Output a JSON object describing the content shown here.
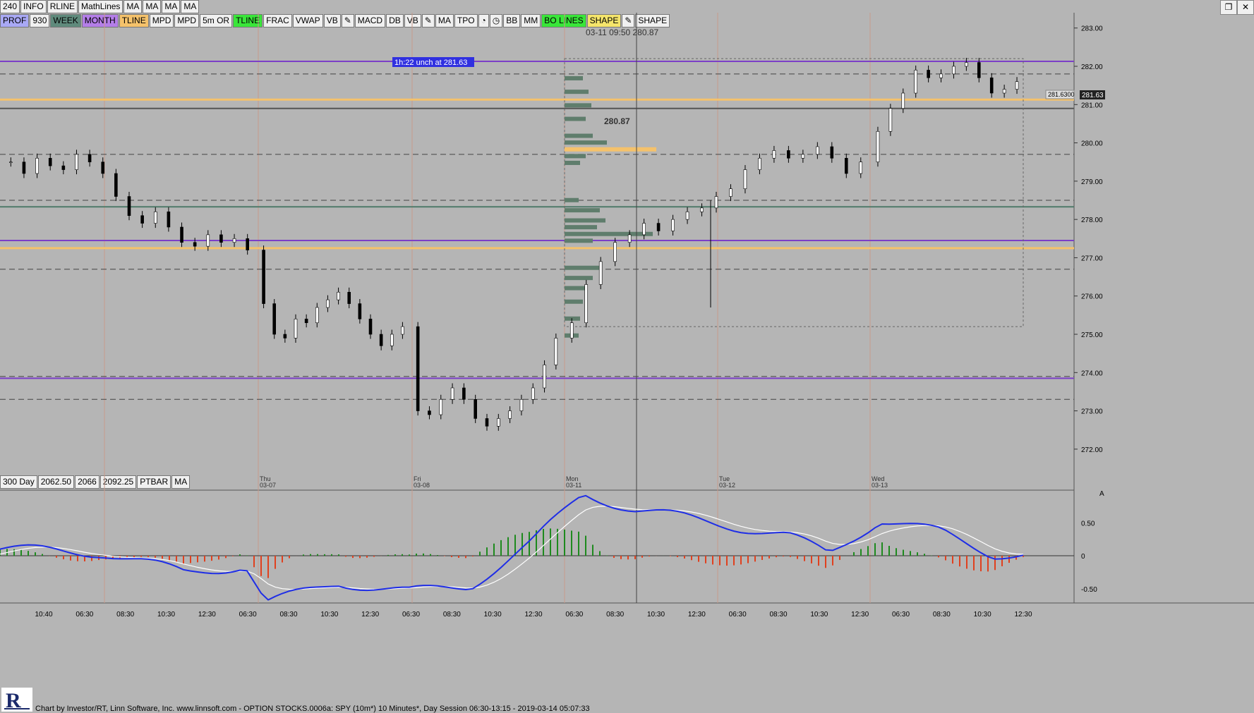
{
  "toolbar_top": [
    "240",
    "INFO",
    "RLINE",
    "MathLines",
    "MA",
    "MA",
    "MA",
    "MA"
  ],
  "toolbar_second": [
    {
      "label": "PROF",
      "bg": "#a9a9f5"
    },
    {
      "label": "930",
      "bg": "#f0f0f0"
    },
    {
      "label": "WEEK",
      "bg": "#5f8a7c"
    },
    {
      "label": "MONTH",
      "bg": "#b47ee8"
    },
    {
      "label": "TLINE",
      "bg": "#f5c26b"
    },
    {
      "label": "MPD",
      "bg": "#f0f0f0"
    },
    {
      "label": "MPD",
      "bg": "#f0f0f0"
    },
    {
      "label": "5m OR",
      "bg": "#f0f0f0"
    },
    {
      "label": "TLINE",
      "bg": "#39e639"
    },
    {
      "label": "FRAC",
      "bg": "#f0f0f0"
    },
    {
      "label": "VWAP",
      "bg": "#f0f0f0"
    },
    {
      "label": "VB",
      "bg": "#f0f0f0"
    },
    {
      "label": "✎",
      "bg": "#f0f0f0"
    },
    {
      "label": "MACD",
      "bg": "#f0f0f0"
    },
    {
      "label": "DB",
      "bg": "#f0f0f0"
    },
    {
      "label": "VB",
      "bg": "#f0f0f0"
    },
    {
      "label": "✎",
      "bg": "#f0f0f0"
    },
    {
      "label": "MA",
      "bg": "#f0f0f0"
    },
    {
      "label": "TPO",
      "bg": "#f0f0f0"
    },
    {
      "label": "◔",
      "bg": "#f0f0f0"
    },
    {
      "label": "◷",
      "bg": "#f0f0f0"
    },
    {
      "label": "BB",
      "bg": "#f0f0f0"
    },
    {
      "label": "MM",
      "bg": "#f0f0f0"
    },
    {
      "label": "BO LINES",
      "bg": "#39e639"
    },
    {
      "label": "SHAPE",
      "bg": "#f5e56b"
    },
    {
      "label": "✎",
      "bg": "#f0f0f0"
    },
    {
      "label": "SHAPE",
      "bg": "#f0f0f0"
    }
  ],
  "toolbar_bottom": [
    "300 Day",
    "2062.50",
    "2066",
    "2092.25",
    "PTBAR",
    "MA"
  ],
  "window_controls": [
    "❐",
    "✕"
  ],
  "footer_text": "Chart by Investor/RT, Linn Software, Inc. www.linnsoft.com - OPTION STOCKS.0006a: SPY (10m*) 10 Minutes*, Day Session 06:30-13:15 - 2019-03-14 05:07:33",
  "colors": {
    "up": "#ffffff",
    "down": "#000000",
    "purple": "#7b3fc7",
    "orange": "#f5c26b",
    "green_line": "#4f7a6a",
    "macd": "#1f2ee6",
    "signal": "#ffffff",
    "hist_pos": "#1e8a1e",
    "hist_neg": "#e0401e",
    "banner": "#3030e0"
  },
  "chart_data": {
    "type": "candlestick",
    "symbol": "SPY",
    "interval": "10 Minutes",
    "y_ticks": [
      272.0,
      273.0,
      274.0,
      275.0,
      276.0,
      277.0,
      278.0,
      279.0,
      280.0,
      281.0,
      282.0,
      283.0
    ],
    "ylim": [
      271.5,
      283.4
    ],
    "day_labels": [
      {
        "day": "Thu",
        "date": "03-07"
      },
      {
        "day": "Fri",
        "date": "03-08"
      },
      {
        "day": "Mon",
        "date": "03-11"
      },
      {
        "day": "Tue",
        "date": "03-12"
      },
      {
        "day": "Wed",
        "date": "03-13"
      }
    ],
    "time_ticks": [
      "10:40",
      "06:30",
      "08:30",
      "10:30",
      "12:30",
      "06:30",
      "08:30",
      "10:30",
      "12:30",
      "06:30",
      "08:30",
      "10:30",
      "12:30",
      "06:30",
      "08:30",
      "10:30",
      "12:30",
      "06:30",
      "08:30",
      "10:30",
      "12:30",
      "06:30",
      "08:30",
      "10:30",
      "12:30"
    ],
    "crosshair_label": "03-11 09:50",
    "crosshair_price": "280.87",
    "profile_poc_label": "280.87",
    "banner": "1h:22  unch at 281.63",
    "last_price": "281.6300",
    "last_price_short": "281.63",
    "horizontal_levels": [
      {
        "price": 281.13,
        "color": "orange",
        "style": "solid"
      },
      {
        "price": 282.13,
        "color": "purple",
        "style": "solid"
      },
      {
        "price": 280.9,
        "color": "dark",
        "style": "solid"
      },
      {
        "price": 278.33,
        "color": "green",
        "style": "solid"
      },
      {
        "price": 277.45,
        "color": "purple",
        "style": "solid"
      },
      {
        "price": 277.25,
        "color": "orange",
        "style": "solid"
      },
      {
        "price": 273.85,
        "color": "purple",
        "style": "solid"
      }
    ],
    "candle_path": [
      279.5,
      279.2,
      279.6,
      279.4,
      279.3,
      279.7,
      279.5,
      279.2,
      278.6,
      278.1,
      277.9,
      278.2,
      277.8,
      277.4,
      277.3,
      277.6,
      277.4,
      277.5,
      277.2,
      275.8,
      275.0,
      274.9,
      275.4,
      275.3,
      275.7,
      275.9,
      276.1,
      275.8,
      275.4,
      275.0,
      274.7,
      275.0,
      275.2,
      273.0,
      272.9,
      273.3,
      273.6,
      273.3,
      272.8,
      272.6,
      272.8,
      273.0,
      273.3,
      273.6,
      274.2,
      274.9,
      275.3,
      276.3,
      276.9,
      277.4,
      277.6,
      277.9,
      277.7,
      278.0,
      278.2,
      278.3,
      278.6,
      278.8,
      279.3,
      279.6,
      279.8,
      279.6,
      279.7,
      279.9,
      279.6,
      279.2,
      279.5,
      280.3,
      280.9,
      281.3,
      281.9,
      281.7,
      281.8,
      282.0,
      282.1,
      281.7,
      281.3,
      281.4,
      281.6
    ],
    "macd_range": [
      -0.75,
      0.75
    ],
    "macd_ticks": [
      "0.50",
      "0",
      "-0.50"
    ],
    "macd_label": "A"
  }
}
